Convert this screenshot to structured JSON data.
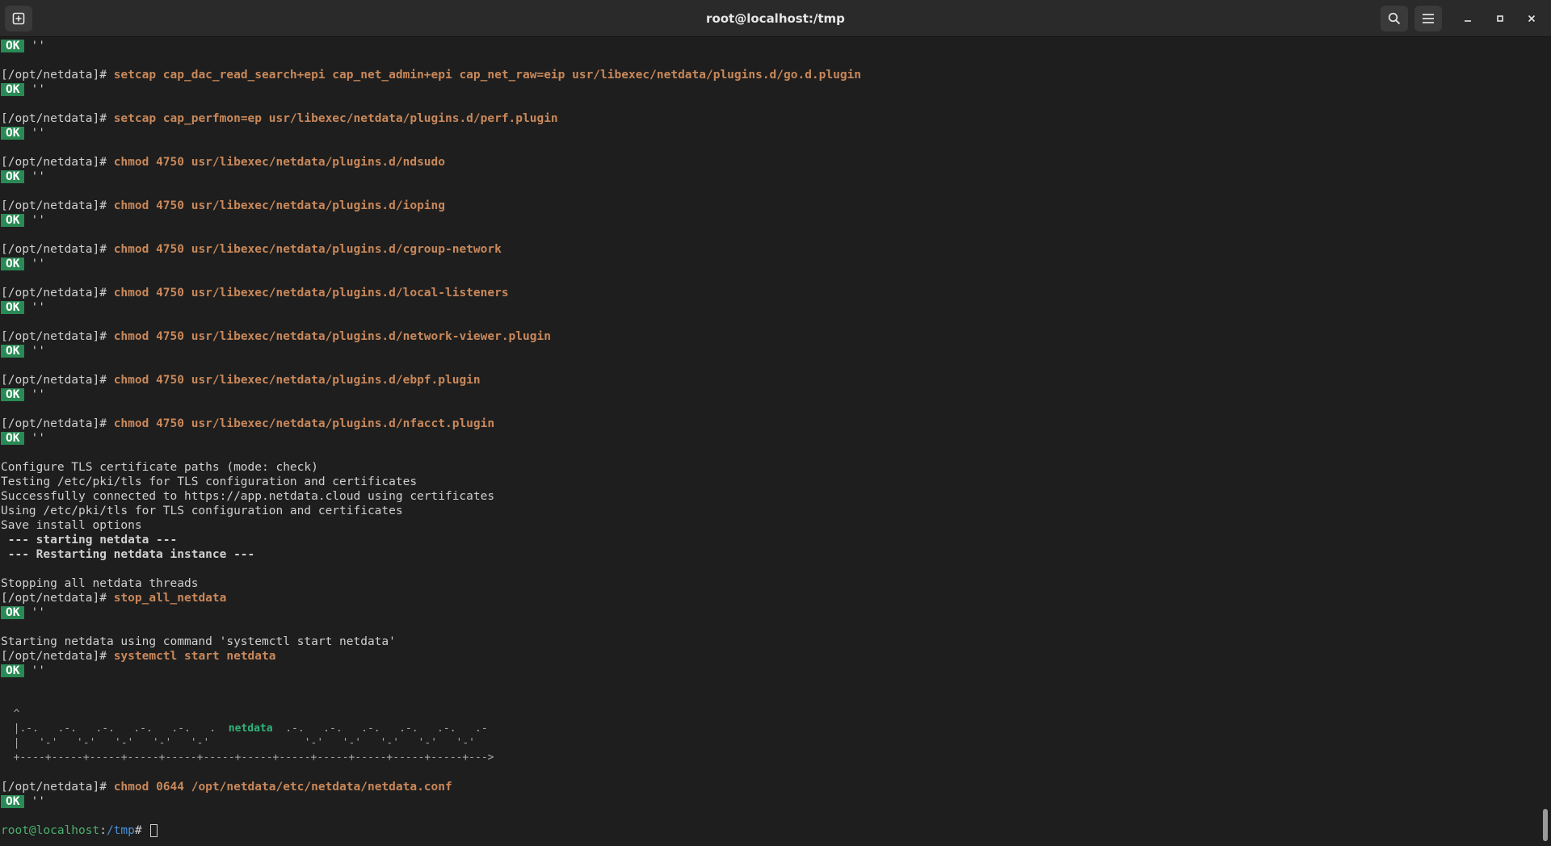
{
  "window": {
    "title": "root@localhost:/tmp",
    "new_tab_icon": "new-tab-icon",
    "search_icon": "search-icon",
    "menu_icon": "hamburger-menu-icon",
    "minimize_icon": "minimize-icon",
    "maximize_icon": "maximize-icon",
    "close_icon": "close-icon"
  },
  "ok_label": "OK",
  "ok_suffix": "''",
  "prompt": "[/opt/netdata]# ",
  "commands": [
    "setcap cap_dac_read_search+epi cap_net_admin+epi cap_net_raw=eip usr/libexec/netdata/plugins.d/go.d.plugin",
    "setcap cap_perfmon=ep usr/libexec/netdata/plugins.d/perf.plugin",
    "chmod 4750 usr/libexec/netdata/plugins.d/ndsudo",
    "chmod 4750 usr/libexec/netdata/plugins.d/ioping",
    "chmod 4750 usr/libexec/netdata/plugins.d/cgroup-network",
    "chmod 4750 usr/libexec/netdata/plugins.d/local-listeners",
    "chmod 4750 usr/libexec/netdata/plugins.d/network-viewer.plugin",
    "chmod 4750 usr/libexec/netdata/plugins.d/ebpf.plugin",
    "chmod 4750 usr/libexec/netdata/plugins.d/nfacct.plugin"
  ],
  "output": {
    "tls_1": "Configure TLS certificate paths (mode: check)",
    "tls_2": "Testing /etc/pki/tls for TLS configuration and certificates",
    "tls_3": "Successfully connected to https://app.netdata.cloud using certificates",
    "tls_4": "Using /etc/pki/tls for TLS configuration and certificates",
    "save": "Save install options",
    "starting": " --- starting netdata ---",
    "restarting": " --- Restarting netdata instance ---",
    "stopping": "Stopping all netdata threads",
    "stop_cmd": "stop_all_netdata",
    "start_msg": "Starting netdata using command 'systemctl start netdata'",
    "start_cmd": "systemctl start netdata",
    "chmod_conf": "chmod 0644 /opt/netdata/etc/netdata/netdata.conf"
  },
  "logo": {
    "line1": "  ^",
    "line2_left": "  |.-.   .-.   .-.   .-.   .-.   .  ",
    "word": "netdata",
    "line2_right": "  .-.   .-.   .-.   .-.   .-.   .-",
    "line3": "  |   '-'   '-'   '-'   '-'   '-'               '-'   '-'   '-'   '-'   '-'",
    "line4": "  +----+-----+-----+-----+-----+-----+-----+-----+-----+-----+-----+-----+--->"
  },
  "final_prompt": {
    "user_host": "root@localhost",
    "sep": ":",
    "path": "/tmp",
    "hash": "# "
  }
}
